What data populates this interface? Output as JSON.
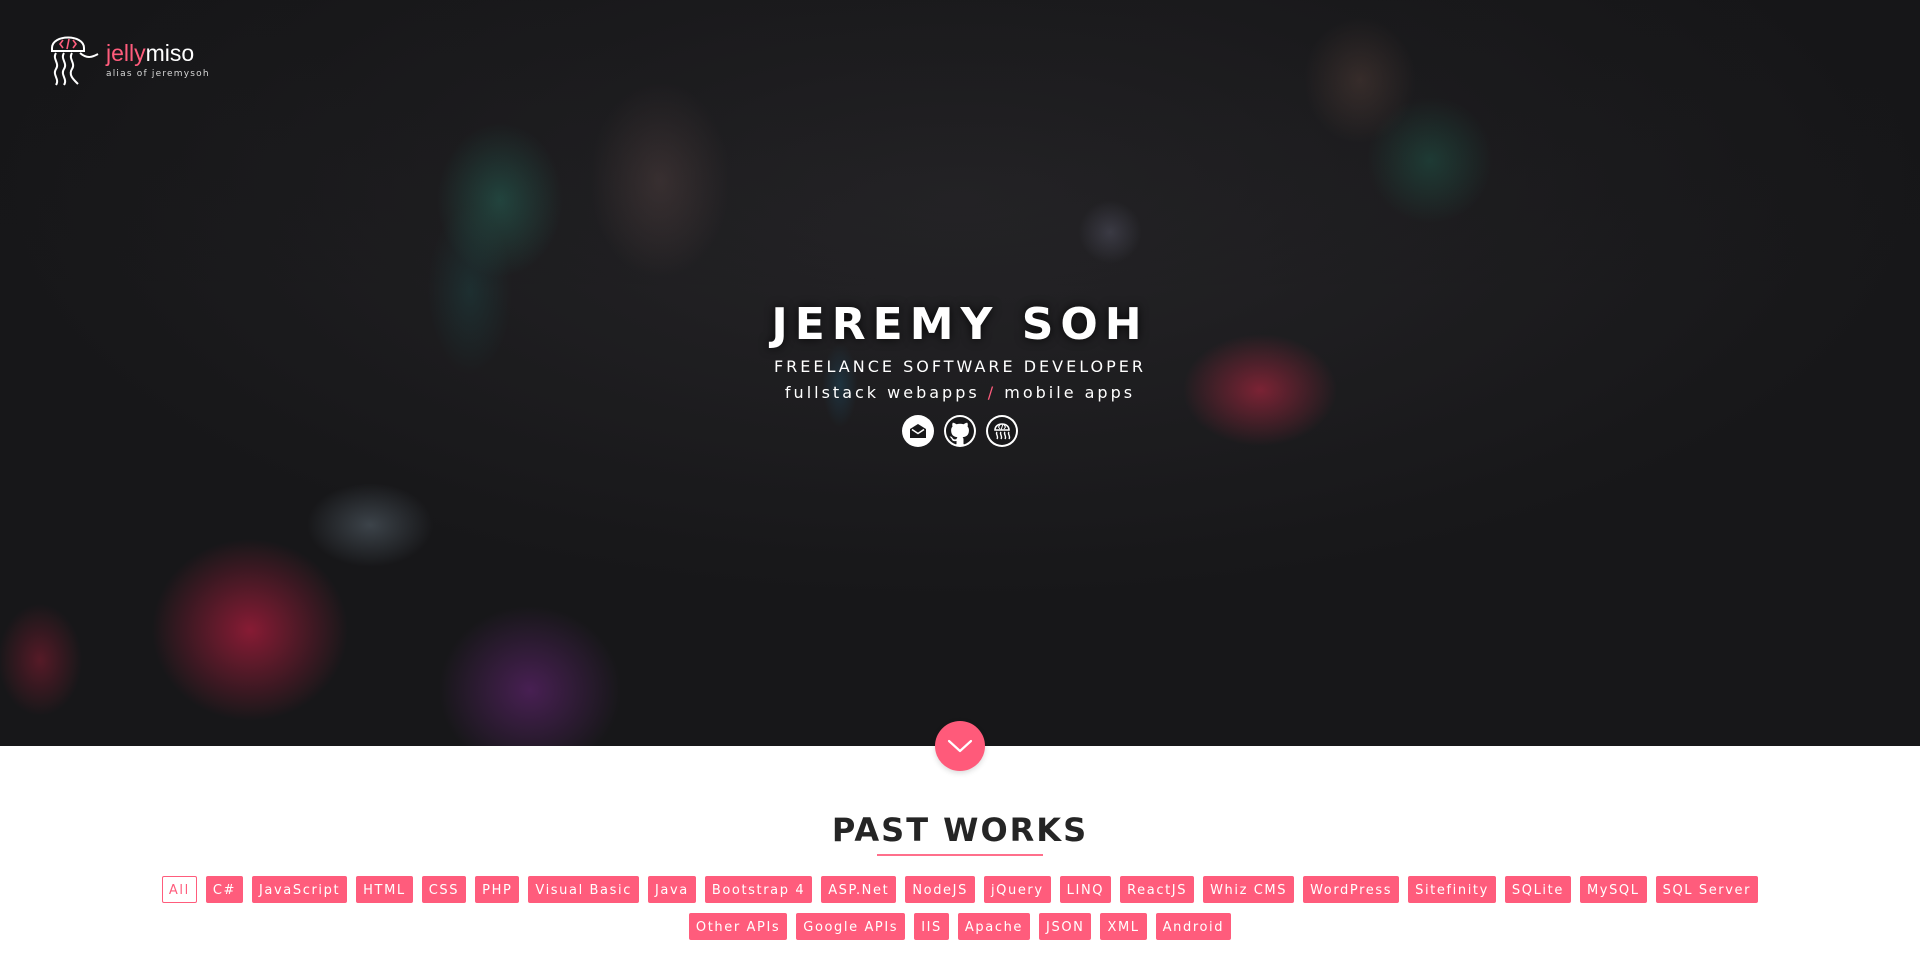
{
  "logo": {
    "name_part1": "jelly",
    "name_part2": "miso",
    "tagline": "alias of jeremysoh"
  },
  "hero": {
    "name": "JEREMY SOH",
    "role": "FREELANCE SOFTWARE DEVELOPER",
    "sub_left": "fullstack webapps",
    "sub_sep": "/",
    "sub_right": "mobile apps",
    "socials": [
      {
        "icon": "email-icon"
      },
      {
        "icon": "github-icon"
      },
      {
        "icon": "jellymiso-icon"
      }
    ]
  },
  "scroll": {
    "icon": "chevron-down-icon"
  },
  "works": {
    "title": "PAST WORKS",
    "filters": [
      "All",
      "C#",
      "JavaScript",
      "HTML",
      "CSS",
      "PHP",
      "Visual Basic",
      "Java",
      "Bootstrap 4",
      "ASP.Net",
      "NodeJS",
      "jQuery",
      "LINQ",
      "ReactJS",
      "Whiz CMS",
      "WordPress",
      "Sitefinity",
      "SQLite",
      "MySQL",
      "SQL Server",
      "Other APIs",
      "Google APIs",
      "IIS",
      "Apache",
      "JSON",
      "XML",
      "Android"
    ],
    "active_filter": "All"
  },
  "colors": {
    "accent": "#ff5c7c",
    "hero_bg": "#18181a",
    "title": "#252525"
  }
}
